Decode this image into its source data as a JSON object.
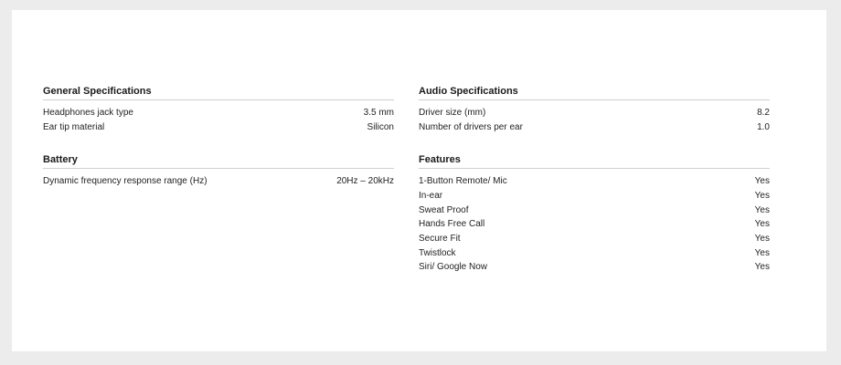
{
  "sections": {
    "general": {
      "title": "General Specifications",
      "rows": [
        {
          "label": "Headphones jack type",
          "value": "3.5 mm"
        },
        {
          "label": "Ear tip material",
          "value": "Silicon"
        }
      ]
    },
    "battery": {
      "title": "Battery",
      "rows": [
        {
          "label": "Dynamic frequency response range (Hz)",
          "value": "20Hz – 20kHz"
        }
      ]
    },
    "audio": {
      "title": "Audio Specifications",
      "rows": [
        {
          "label": "Driver size (mm)",
          "value": "8.2"
        },
        {
          "label": "Number of drivers per ear",
          "value": "1.0"
        }
      ]
    },
    "features": {
      "title": "Features",
      "rows": [
        {
          "label": "1-Button Remote/ Mic",
          "value": "Yes"
        },
        {
          "label": "In-ear",
          "value": "Yes"
        },
        {
          "label": "Sweat Proof",
          "value": "Yes"
        },
        {
          "label": "Hands Free Call",
          "value": "Yes"
        },
        {
          "label": "Secure Fit",
          "value": "Yes"
        },
        {
          "label": "Twistlock",
          "value": "Yes"
        },
        {
          "label": "Siri/ Google Now",
          "value": "Yes"
        }
      ]
    }
  }
}
